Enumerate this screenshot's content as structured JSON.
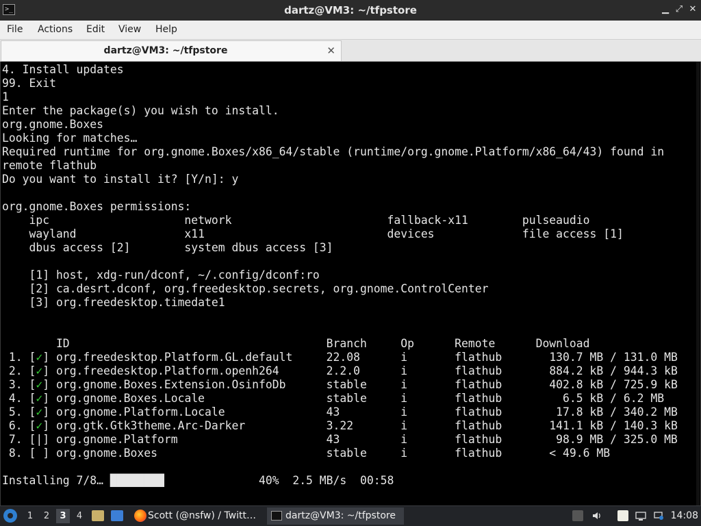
{
  "window": {
    "title": "dartz@VM3: ~/tfpstore",
    "minimize_glyph": "▁",
    "maximize_glyph": "⤢",
    "close_glyph": "✕"
  },
  "menu": [
    "File",
    "Actions",
    "Edit",
    "View",
    "Help"
  ],
  "tab": {
    "label": "dartz@VM3: ~/tfpstore",
    "close_glyph": "✕"
  },
  "terminal_lines": [
    "4. Install updates",
    "99. Exit",
    "1",
    "Enter the package(s) you wish to install.",
    "org.gnome.Boxes",
    "Looking for matches…",
    "Required runtime for org.gnome.Boxes/x86_64/stable (runtime/org.gnome.Platform/x86_64/43) found in",
    "remote flathub",
    "Do you want to install it? [Y/n]: y",
    "",
    "org.gnome.Boxes permissions:",
    "    ipc                    network                       fallback-x11        pulseaudio",
    "    wayland                x11                           devices             file access [1]",
    "    dbus access [2]        system dbus access [3]",
    "",
    "    [1] host, xdg-run/dconf, ~/.config/dconf:ro",
    "    [2] ca.desrt.dconf, org.freedesktop.secrets, org.gnome.ControlCenter",
    "    [3] org.freedesktop.timedate1",
    "",
    "",
    "        ID                                      Branch     Op      Remote      Download",
    " 1. [✓] org.freedesktop.Platform.GL.default     22.08      i       flathub       130.7 MB / 131.0 MB",
    " 2. [✓] org.freedesktop.Platform.openh264       2.2.0      i       flathub       884.2 kB / 944.3 kB",
    " 3. [✓] org.gnome.Boxes.Extension.OsinfoDb      stable     i       flathub       402.8 kB / 725.9 kB",
    " 4. [✓] org.gnome.Boxes.Locale                  stable     i       flathub         6.5 kB / 6.2 MB",
    " 5. [✓] org.gnome.Platform.Locale               43         i       flathub        17.8 kB / 340.2 MB",
    " 6. [✓] org.gtk.Gtk3theme.Arc-Darker            3.22       i       flathub       141.1 kB / 140.3 kB",
    " 7. [|] org.gnome.Platform                      43         i       flathub        98.9 MB / 325.0 MB",
    " 8. [ ] org.gnome.Boxes                         stable     i       flathub       < 49.6 MB",
    "",
    "Installing 7/8… ████████              40%  2.5 MB/s  00:58"
  ],
  "taskbar": {
    "workspaces": [
      "1",
      "2",
      "3",
      "4"
    ],
    "active_workspace": "3",
    "tasks": [
      {
        "label": "Scott (@nsfw) / Twitt…",
        "icon": "firefox-icon"
      },
      {
        "label": "dartz@VM3: ~/tfpstore",
        "icon": "terminal-icon"
      }
    ],
    "clock": "14:08"
  },
  "colors": {
    "titlebar": "#2b2b2b",
    "terminal_bg": "#000000",
    "terminal_fg": "#e6e6e6",
    "taskbar": "#222428",
    "check_green": "#33cc33"
  }
}
